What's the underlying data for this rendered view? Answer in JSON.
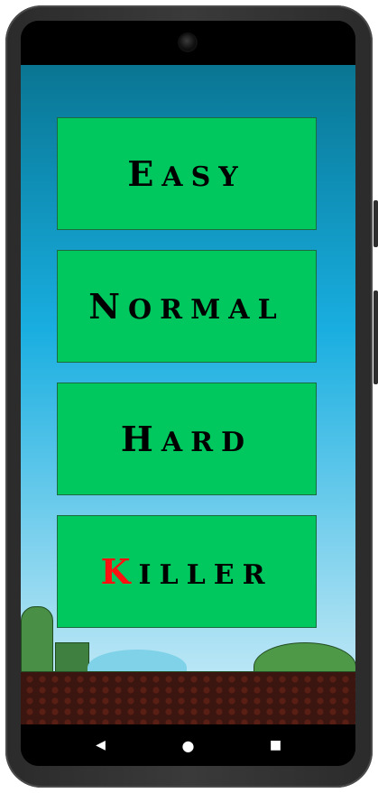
{
  "menu": {
    "easy": {
      "first": "E",
      "rest": "ASY"
    },
    "normal": {
      "first": "N",
      "rest": "ORMAL"
    },
    "hard": {
      "first": "H",
      "rest": "ARD"
    },
    "killer": {
      "first": "K",
      "rest": "ILLER"
    }
  },
  "colors": {
    "button_fill": "#00c75e",
    "killer_accent": "#ff1111",
    "sky_top": "#0a7592",
    "sky_bottom": "#cdeefa"
  },
  "nav": {
    "back_icon": "◀",
    "home_icon": "●",
    "recents_icon": "■"
  }
}
